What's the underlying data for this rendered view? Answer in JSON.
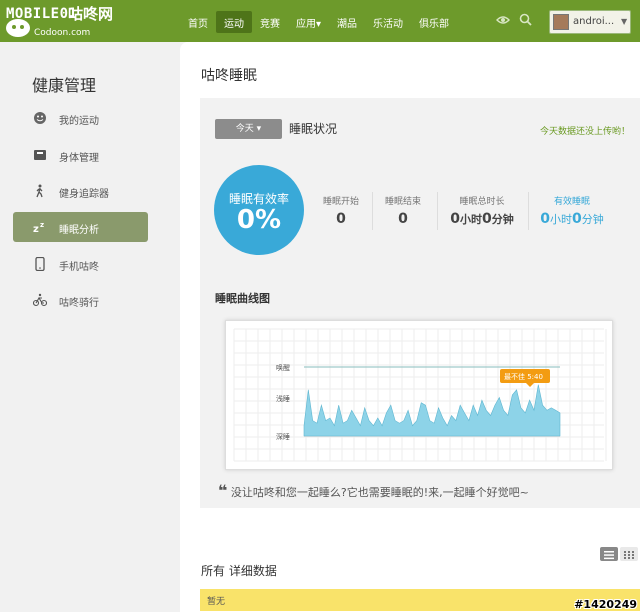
{
  "brand": {
    "name": "MOBILE01",
    "cn": "咕咚网",
    "sub": "Codoon.com"
  },
  "nav": [
    "首页",
    "运动",
    "竞赛",
    "应用▾",
    "潮品",
    "乐活动",
    "俱乐部"
  ],
  "nav_active": 1,
  "user": {
    "name": "androi..."
  },
  "sidebar": {
    "title": "健康管理",
    "items": [
      {
        "label": "我的运动",
        "icon": "smile-icon"
      },
      {
        "label": "身体管理",
        "icon": "scale-icon"
      },
      {
        "label": "健身追踪器",
        "icon": "walking-icon"
      },
      {
        "label": "睡眠分析",
        "icon": "sleep-zz-icon"
      },
      {
        "label": "手机咕咚",
        "icon": "phone-icon"
      },
      {
        "label": "咕咚骑行",
        "icon": "bike-icon"
      }
    ],
    "active_index": 3
  },
  "main": {
    "title": "咕咚睡眠",
    "today_label": "今天 ▾",
    "status_label": "睡眠状况",
    "upload_note": "今天数据还没上传哟！",
    "efficiency": {
      "label": "睡眠有效率",
      "value": "0%"
    },
    "stats": {
      "start": {
        "label": "睡眠开始",
        "value": "0"
      },
      "end": {
        "label": "睡眠结束",
        "value": "0"
      },
      "total": {
        "label": "睡眠总时长",
        "h": "0",
        "h_unit": "小时",
        "m": "0",
        "m_unit": "分钟"
      },
      "effective": {
        "label": "有效睡眠",
        "h": "0",
        "h_unit": "小时",
        "m": "0",
        "m_unit": "分钟"
      }
    },
    "curve_title": "睡眠曲线图",
    "quote": "没让咕咚和您一起睡么?它也需要睡眠的!来,一起睡个好觉吧~",
    "detail_title": "所有 详细数据",
    "empty_text": "暂无"
  },
  "chart_data": {
    "type": "area",
    "y_categories": [
      "深睡",
      "浅睡",
      "唤醒"
    ],
    "tooltip": "最不佳 5:40",
    "colors": {
      "fill": "#8dd3e8",
      "line": "#5fb6d0",
      "tooltip": "#f39c12"
    },
    "values": [
      0.2,
      0.9,
      0.3,
      0.25,
      0.6,
      0.3,
      0.35,
      0.2,
      0.6,
      0.25,
      0.3,
      0.5,
      0.35,
      0.2,
      0.55,
      0.3,
      0.2,
      0.35,
      0.2,
      0.45,
      0.6,
      0.3,
      0.25,
      0.3,
      0.5,
      0.2,
      0.3,
      0.65,
      0.6,
      0.3,
      0.25,
      0.55,
      0.35,
      0.2,
      0.4,
      0.3,
      0.6,
      0.45,
      0.3,
      0.6,
      0.4,
      0.7,
      0.5,
      0.4,
      0.6,
      0.75,
      0.5,
      0.4,
      0.8,
      0.9,
      0.55,
      0.45,
      0.7,
      0.5,
      1.0,
      0.6,
      0.5,
      0.55,
      0.5,
      0.45
    ]
  },
  "watermark": "#1420249"
}
